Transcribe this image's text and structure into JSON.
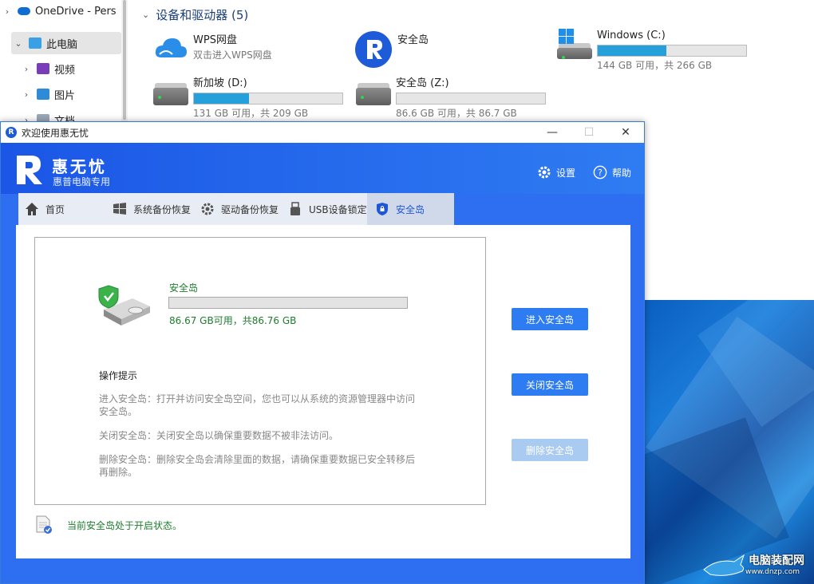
{
  "explorer": {
    "nav": [
      {
        "label": "OneDrive - Pers",
        "chevron": "›"
      },
      {
        "label": "此电脑",
        "chevron": "⌄"
      },
      {
        "label": "视频",
        "chevron": "›"
      },
      {
        "label": "图片",
        "chevron": "›"
      },
      {
        "label": "文档",
        "chevron": "›"
      }
    ],
    "section_title": "设备和驱动器 (5)",
    "drives": [
      {
        "name": "WPS网盘",
        "sub": "双击进入WPS网盘"
      },
      {
        "name": "安全岛"
      },
      {
        "name": "Windows (C:)",
        "sub": "144 GB 可用，共 266 GB",
        "used_fraction": 0.46
      },
      {
        "name": "新加坡 (D:)",
        "sub": "131 GB 可用，共 209 GB",
        "used_fraction": 0.37
      },
      {
        "name": "安全岛 (Z:)",
        "sub": "86.6 GB 可用，共 86.7 GB",
        "used_fraction": 0.0
      }
    ]
  },
  "app": {
    "title": "欢迎使用惠无忧",
    "win_controls": {
      "minimize": "—",
      "maximize": "☐",
      "close": "✕"
    },
    "brand": {
      "name": "惠无忧",
      "subtitle": "惠普电脑专用"
    },
    "header_buttons": {
      "settings": "设置",
      "help": "帮助"
    },
    "tabs": [
      "首页",
      "系统备份恢复",
      "驱动备份恢复",
      "USB设备锁定",
      "安全岛"
    ],
    "active_tab": "安全岛",
    "island": {
      "name": "安全岛",
      "space": "86.67 GB可用，共86.76 GB",
      "used_fraction": 0.0
    },
    "tips": {
      "heading": "操作提示",
      "items": [
        "进入安全岛：打开并访问安全岛空间，您也可以从系统的资源管理器中访问安全岛。",
        "关闭安全岛：关闭安全岛以确保重要数据不被非法访问。",
        "删除安全岛：删除安全岛会清除里面的数据，请确保重要数据已安全转移后再删除。"
      ]
    },
    "actions": {
      "enter": "进入安全岛",
      "close": "关闭安全岛",
      "delete": "删除安全岛"
    },
    "status": "当前安全岛处于开启状态。"
  },
  "watermark": {
    "line1": "电脑装配网",
    "line2": "www.dnzp.com"
  },
  "colors": {
    "accent": "#2d7cf2",
    "header": "#1b56e6",
    "status_green": "#1d7d2e",
    "drive_bar": "#26a0da"
  }
}
